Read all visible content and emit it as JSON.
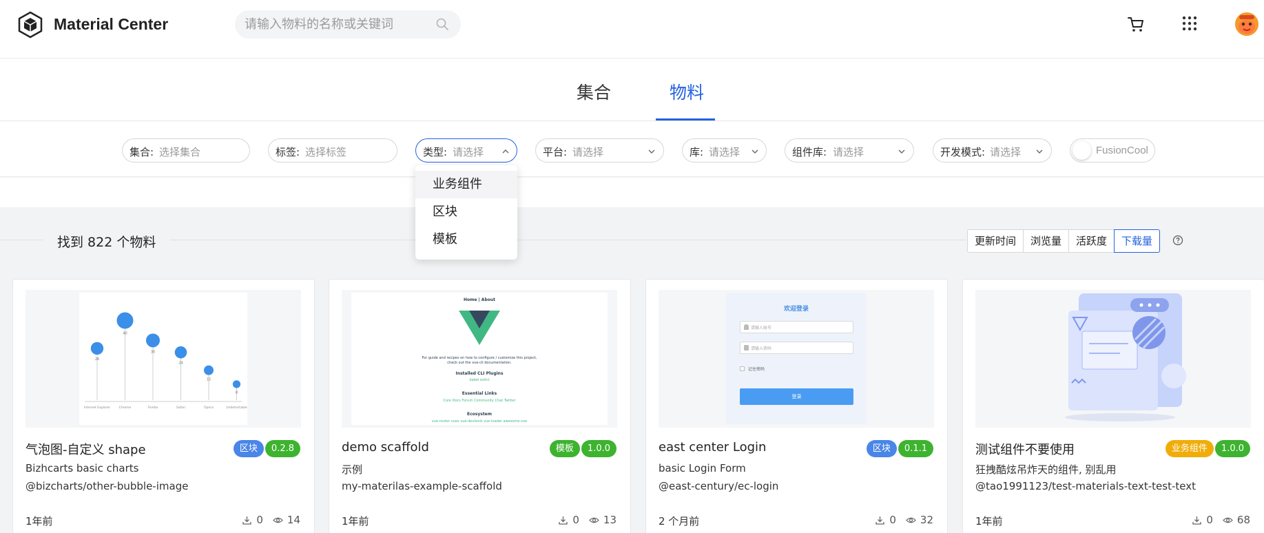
{
  "colors": {
    "accent": "#2462e0",
    "block_badge": "#4a86e8",
    "version_badge": "#3db32f",
    "template_badge": "#3db32f",
    "business_badge": "#f0ad0a"
  },
  "header": {
    "brand": "Material Center",
    "search_placeholder": "请输入物料的名称或关键词",
    "icons": [
      "logo-cube-icon",
      "search-icon",
      "cart-icon",
      "apps-grid-icon",
      "avatar"
    ]
  },
  "tabs": {
    "collection": "集合",
    "material": "物料",
    "active": "物料"
  },
  "filters": {
    "collection": {
      "label": "集合:",
      "value": "选择集合"
    },
    "tag": {
      "label": "标签:",
      "value": "选择标签"
    },
    "type": {
      "label": "类型:",
      "value": "请选择"
    },
    "platform": {
      "label": "平台:",
      "value": "请选择"
    },
    "library": {
      "label": "库:",
      "value": "请选择"
    },
    "component_lib": {
      "label": "组件库:",
      "value": "请选择"
    },
    "dev_mode": {
      "label": "开发模式:",
      "value": "请选择"
    },
    "toggle_label": "FusionCool"
  },
  "type_dropdown": {
    "items": [
      "业务组件",
      "区块",
      "模板"
    ]
  },
  "results": {
    "count_text": "找到 822 个物料",
    "sort": [
      "更新时间",
      "浏览量",
      "活跃度",
      "下载量"
    ],
    "active_sort": "下载量"
  },
  "cards": [
    {
      "title": "气泡图-自定义 shape",
      "type_badge": "区块",
      "version": "0.2.8",
      "desc": "Bizhcarts basic charts",
      "pkg": "@bizcharts/other-bubble-image",
      "time": "1年前",
      "downloads": "0",
      "views": "14",
      "preview": {
        "chart_data": {
          "type": "scatter",
          "categories": [
            "Internet Explorer",
            "Chrome",
            "Firefox",
            "Safari",
            "Opera",
            "Undetectable"
          ],
          "values": [
            26,
            40,
            30,
            24,
            15,
            8
          ]
        }
      }
    },
    {
      "title": "demo scaffold",
      "type_badge": "模板",
      "version": "1.0.0",
      "desc": "示例",
      "pkg": "my-materilas-example-scaffold",
      "time": "1年前",
      "downloads": "0",
      "views": "13",
      "preview": {
        "nav": "Home | About",
        "intro": "For guide and recipes on how to configure / customize this project,",
        "intro2": "check out the vue-cli documentation.",
        "h1": "Installed CLI Plugins",
        "links1": "babel  eslint",
        "h2": "Essential Links",
        "links2": "Core Docs   Forum   Community Chat   Twitter",
        "h3": "Ecosystem",
        "links3": "vue-router   vuex   vue-devtools   vue-loader   awesome-vue"
      }
    },
    {
      "title": "east center Login",
      "type_badge": "区块",
      "version": "0.1.1",
      "desc": "basic Login Form",
      "pkg": "@east-century/ec-login",
      "time": "2 个月前",
      "downloads": "0",
      "views": "32",
      "preview": {
        "heading": "欢迎登录",
        "account_placeholder": "请输入账号",
        "password_placeholder": "请输入密码",
        "remember": "记住密码",
        "login_button": "登录"
      }
    },
    {
      "title": "测试组件不要使用",
      "type_badge": "业务组件",
      "version": "1.0.0",
      "desc": "狂拽酷炫吊炸天的组件, 别乱用",
      "pkg": "@tao1991123/test-materials-text-test-text",
      "time": "1年前",
      "downloads": "0",
      "views": "68"
    }
  ]
}
